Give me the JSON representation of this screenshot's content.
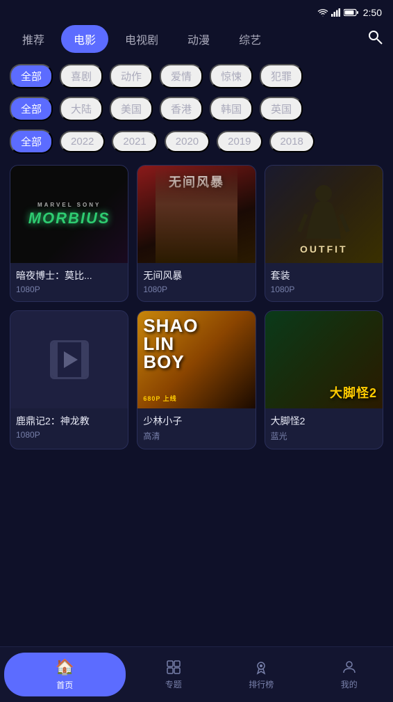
{
  "statusBar": {
    "time": "2:50",
    "icons": [
      "wifi",
      "signal",
      "battery"
    ]
  },
  "topNav": {
    "tabs": [
      "推荐",
      "电影",
      "电视剧",
      "动漫",
      "综艺"
    ],
    "activeTab": "电影",
    "searchLabel": "search"
  },
  "filters": {
    "genre": {
      "all": "全部",
      "options": [
        "喜剧",
        "动作",
        "爱情",
        "惊悚",
        "犯罪"
      ]
    },
    "region": {
      "all": "全部",
      "options": [
        "大陆",
        "美国",
        "香港",
        "韩国",
        "英国"
      ]
    },
    "year": {
      "all": "全部",
      "options": [
        "2022",
        "2021",
        "2020",
        "2019",
        "2018"
      ]
    }
  },
  "movies": [
    {
      "id": "morbius",
      "title": "暗夜博士：莫比...",
      "quality": "1080P",
      "poster": "morbius"
    },
    {
      "id": "wujian",
      "title": "无间风暴",
      "quality": "1080P",
      "poster": "wujian"
    },
    {
      "id": "outfit",
      "title": "套装",
      "quality": "1080P",
      "poster": "outfit"
    },
    {
      "id": "luding",
      "title": "鹿鼎记2：神龙教",
      "quality": "1080P",
      "poster": "luding"
    },
    {
      "id": "shaolin",
      "title": "少林小子",
      "quality": "高清",
      "poster": "shaolin"
    },
    {
      "id": "dajiao",
      "title": "大脚怪2",
      "quality": "蓝光",
      "poster": "dajiao"
    }
  ],
  "bottomNav": {
    "items": [
      "首页",
      "专题",
      "排行榜",
      "我的"
    ],
    "activeItem": "首页",
    "icons": [
      "🏠",
      "▦",
      "🏆",
      "👤"
    ]
  }
}
